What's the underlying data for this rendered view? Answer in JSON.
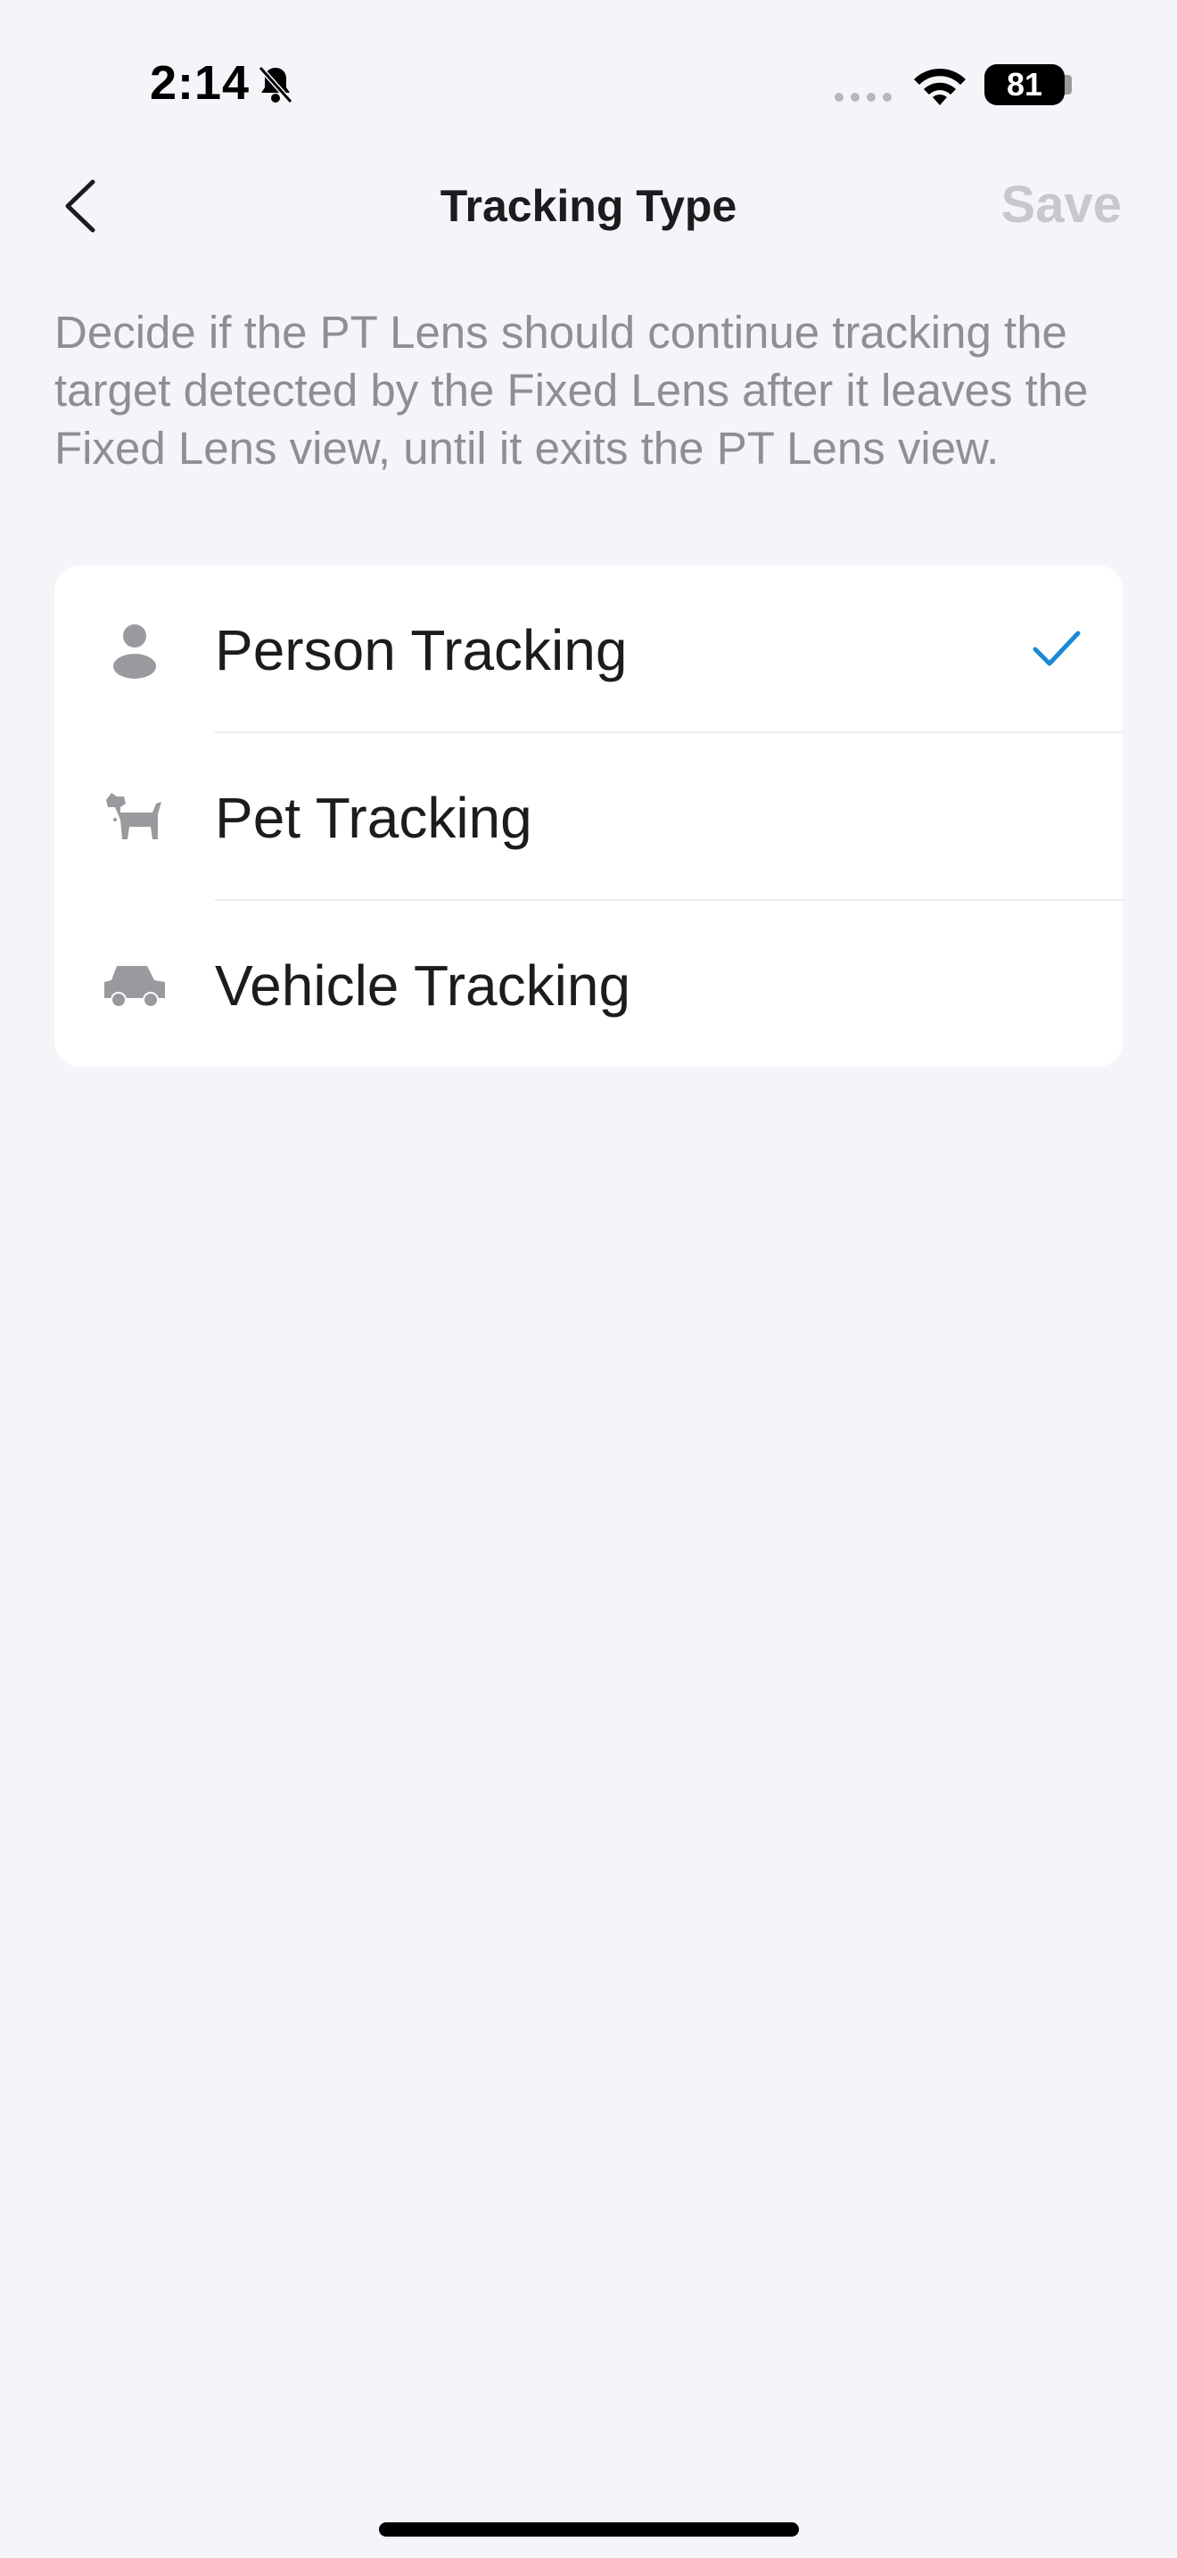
{
  "status_bar": {
    "time": "2:14",
    "battery": "81"
  },
  "nav": {
    "title": "Tracking Type",
    "save_label": "Save"
  },
  "description": "Decide if the PT Lens should continue tracking the target detected by the Fixed Lens after it leaves the Fixed Lens view, until it exits the PT Lens view.",
  "options": [
    {
      "label": "Person Tracking",
      "icon": "person-icon",
      "selected": true
    },
    {
      "label": "Pet Tracking",
      "icon": "dog-icon",
      "selected": false
    },
    {
      "label": "Vehicle Tracking",
      "icon": "car-icon",
      "selected": false
    }
  ],
  "colors": {
    "background": "#f4f5f9",
    "accent": "#1a8ad6",
    "save_disabled": "#c6c8cc",
    "secondary_text": "#8e8e93",
    "icon_gray": "#9a9a9e"
  }
}
